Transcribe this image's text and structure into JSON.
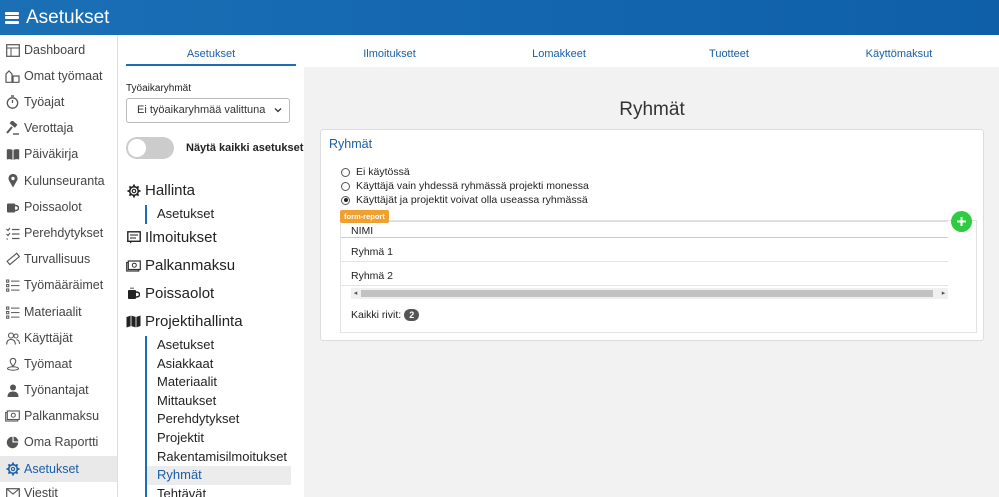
{
  "app": {
    "title": "Asetukset"
  },
  "sidebar": {
    "items": [
      {
        "label": "Dashboard",
        "icon": "dashboard-icon"
      },
      {
        "label": "Omat työmaat",
        "icon": "site-icon"
      },
      {
        "label": "Työajat",
        "icon": "stopwatch-icon"
      },
      {
        "label": "Verottaja",
        "icon": "gavel-icon"
      },
      {
        "label": "Päiväkirja",
        "icon": "book-icon"
      },
      {
        "label": "Kulunseuranta",
        "icon": "map-marker-icon"
      },
      {
        "label": "Poissaolot",
        "icon": "coffee-icon"
      },
      {
        "label": "Perehdytykset",
        "icon": "checklist-icon"
      },
      {
        "label": "Turvallisuus",
        "icon": "ruler-icon"
      },
      {
        "label": "Työmääräimet",
        "icon": "list-icon"
      },
      {
        "label": "Materiaalit",
        "icon": "list-icon"
      },
      {
        "label": "Käyttäjät",
        "icon": "users-icon"
      },
      {
        "label": "Työmaat",
        "icon": "location-icon"
      },
      {
        "label": "Työnantajat",
        "icon": "user-icon"
      },
      {
        "label": "Palkanmaksu",
        "icon": "money-icon"
      },
      {
        "label": "Oma Raportti",
        "icon": "pie-chart-icon"
      },
      {
        "label": "Asetukset",
        "icon": "gear-icon",
        "active": true
      },
      {
        "label": "Viestit",
        "icon": "envelope-icon"
      }
    ]
  },
  "tabs": [
    {
      "label": "Asetukset",
      "active": true
    },
    {
      "label": "Ilmoitukset"
    },
    {
      "label": "Lomakkeet"
    },
    {
      "label": "Tuotteet"
    },
    {
      "label": "Käyttömaksut"
    }
  ],
  "filters": {
    "group_label": "Työaikaryhmät",
    "group_value": "Ei työaikaryhmää valittuna",
    "toggle_label": "Näytä kaikki asetukset",
    "toggle_on": false
  },
  "menu": {
    "hallinta": "Hallinta",
    "hallinta_sub": [
      "Asetukset"
    ],
    "ilmoitukset": "Ilmoitukset",
    "palkanmaksu": "Palkanmaksu",
    "poissaolot": "Poissaolot",
    "projektihallinta": "Projektihallinta",
    "projekti_sub": [
      "Asetukset",
      "Asiakkaat",
      "Materiaalit",
      "Mittaukset",
      "Perehdytykset",
      "Projektit",
      "Rakentamisilmoitukset",
      "Ryhmät",
      "Tehtävät"
    ],
    "projekti_active": "Ryhmät"
  },
  "main": {
    "title": "Ryhmät",
    "card_title": "Ryhmät",
    "radios": [
      {
        "label": "Ei käytössä",
        "checked": false
      },
      {
        "label": "Käyttäjä vain yhdessä ryhmässä projekti monessa",
        "checked": false
      },
      {
        "label": "Käyttäjät ja projektit voivat olla useassa ryhmässä",
        "checked": true
      }
    ],
    "badge": "form-report",
    "table": {
      "header": "NIMI",
      "rows": [
        "Ryhmä 1",
        "Ryhmä 2"
      ]
    },
    "total_label": "Kaikki rivit:",
    "total_count": "2"
  },
  "colors": {
    "accent": "#1a6fb5",
    "add": "#2ecc40",
    "badge": "#f0a030"
  }
}
